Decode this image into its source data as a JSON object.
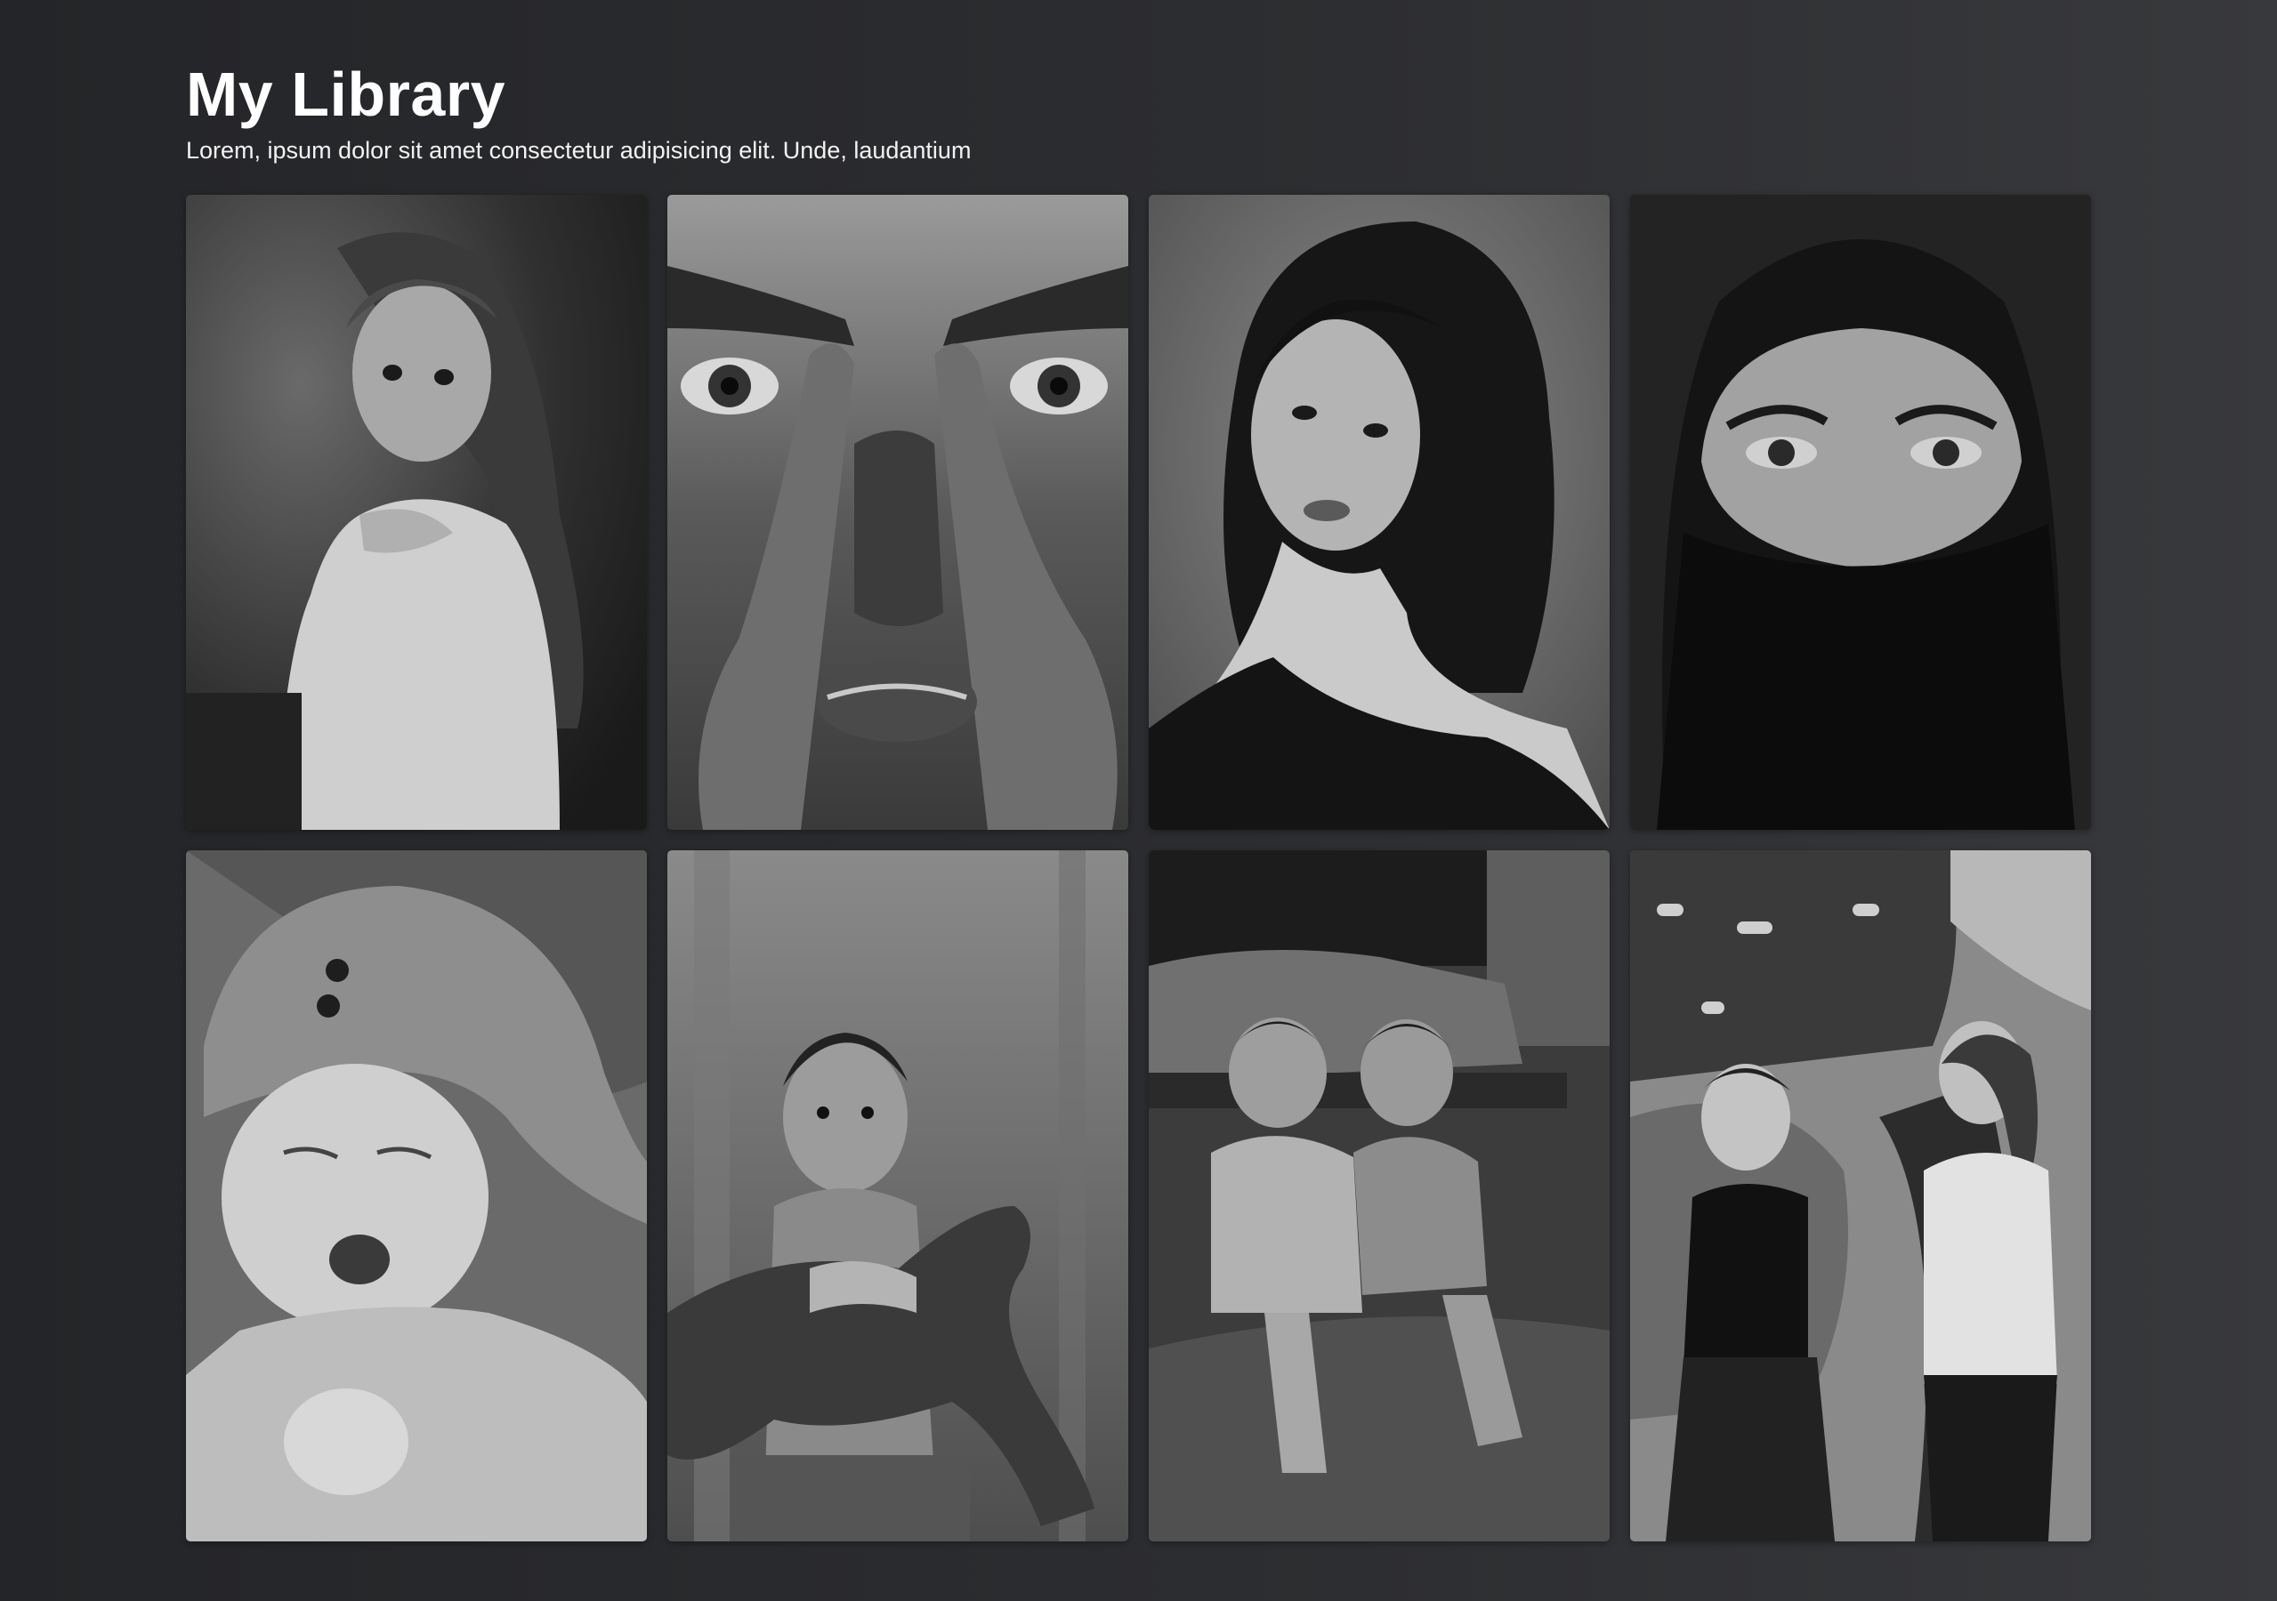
{
  "header": {
    "title": "My Library",
    "subtitle": "Lorem, ipsum dolor sit amet consectetur adipisicing elit. Unde, laudantium"
  },
  "gallery": {
    "style": "grayscale",
    "items": [
      {
        "subject": "girl-in-lace-dress-portrait"
      },
      {
        "subject": "man-painted-face-hands-over-cheeks"
      },
      {
        "subject": "woman-dark-hair-portrait"
      },
      {
        "subject": "woman-in-niqab-eyes"
      },
      {
        "subject": "yawning-baby-in-knit-hat"
      },
      {
        "subject": "boy-holding-goat"
      },
      {
        "subject": "two-children-sitting-on-rocks"
      },
      {
        "subject": "two-women-with-drinks-by-mural"
      }
    ]
  }
}
